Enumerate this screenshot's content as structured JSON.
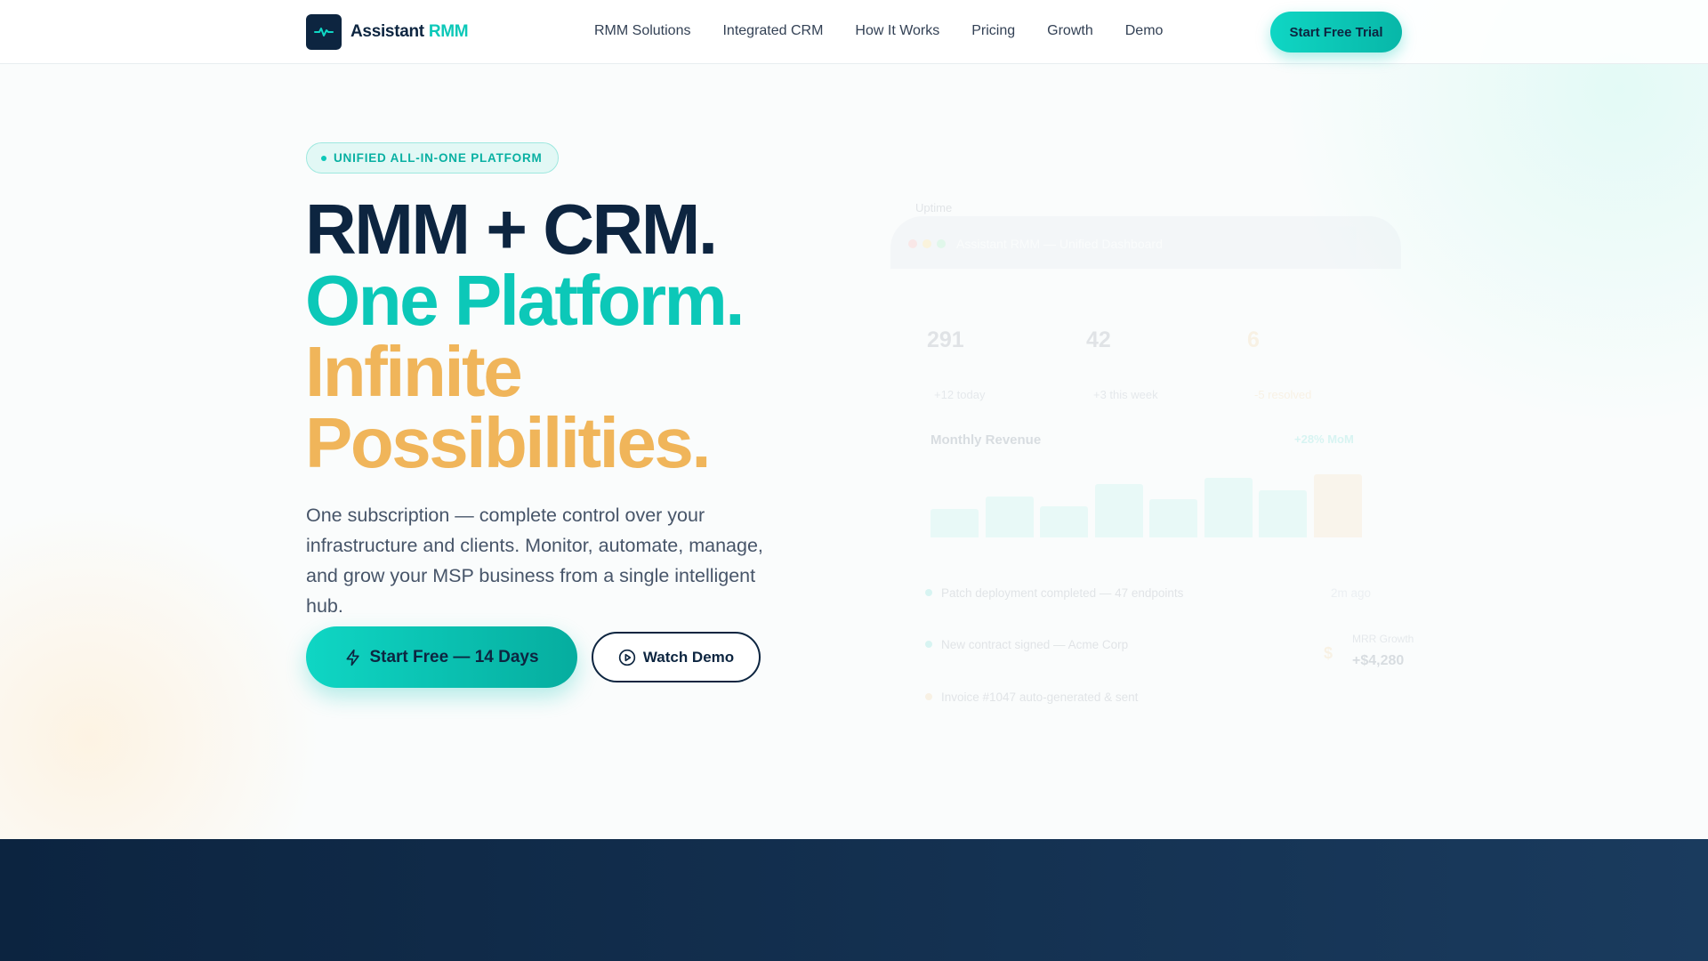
{
  "brand": {
    "name": "Assistant",
    "accent": "RMM"
  },
  "nav": {
    "links": [
      "RMM Solutions",
      "Integrated CRM",
      "How It Works",
      "Pricing",
      "Growth",
      "Demo"
    ],
    "cta": "Start Free Trial"
  },
  "hero": {
    "badge": "UNIFIED ALL-IN-ONE PLATFORM",
    "headline": [
      "RMM + CRM.",
      "One Platform.",
      "Infinite",
      "Possibilities."
    ],
    "subtitle": "One subscription — complete control over your infrastructure and clients. Monitor, automate, manage, and grow your MSP business from a single intelligent hub.",
    "primary_cta": "Start Free — 14 Days",
    "secondary_cta": "Watch Demo"
  },
  "dashboard": {
    "float_label": "Uptime",
    "title": "Assistant RMM — Unified Dashboard",
    "stats": [
      {
        "value": "291",
        "sub": "+12 today"
      },
      {
        "value": "42",
        "sub": "+3 this week"
      },
      {
        "value": "6",
        "sub": "-5 resolved"
      }
    ],
    "revenue": {
      "title": "Monthly Revenue",
      "change": "+28% MoM",
      "bars": [
        45,
        65,
        50,
        85,
        60,
        95,
        75,
        100
      ]
    },
    "activity": [
      {
        "text": "Patch deployment completed — 47 endpoints",
        "time": "2m ago"
      },
      {
        "text": "New contract signed — Acme Corp"
      },
      {
        "text": "Invoice #1047 auto-generated & sent"
      }
    ],
    "mrr": {
      "label": "MRR Growth",
      "value": "+$4,280"
    }
  },
  "colors": {
    "navy": "#0d2540",
    "teal": "#0cc8b8",
    "orange": "#f0b55a"
  }
}
